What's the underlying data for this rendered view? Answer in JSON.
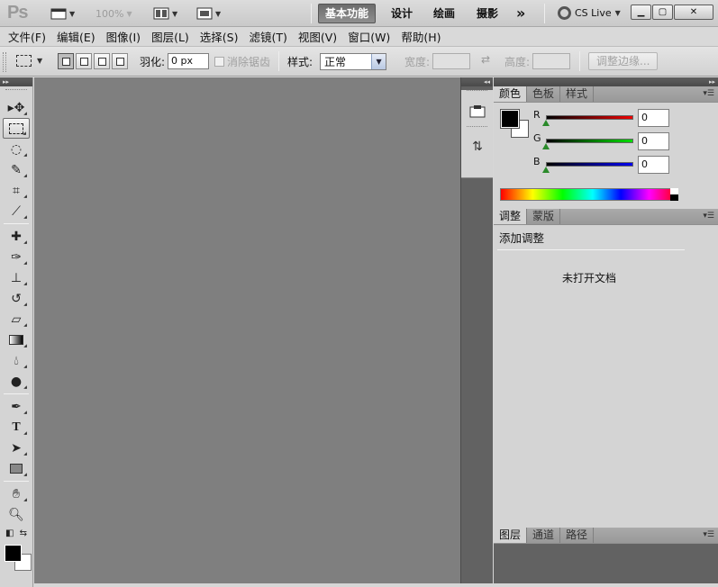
{
  "app": {
    "logo": "Ps",
    "zoom": "100%",
    "workspaces": [
      "基本功能",
      "设计",
      "绘画",
      "摄影"
    ],
    "active_workspace": 0,
    "more": "»",
    "cs_live": "CS Live"
  },
  "menu": [
    "文件(F)",
    "编辑(E)",
    "图像(I)",
    "图层(L)",
    "选择(S)",
    "滤镜(T)",
    "视图(V)",
    "窗口(W)",
    "帮助(H)"
  ],
  "options": {
    "feather_label": "羽化:",
    "feather_value": "0 px",
    "antialias_label": "消除锯齿",
    "style_label": "样式:",
    "style_value": "正常",
    "width_label": "宽度:",
    "height_label": "高度:",
    "refine_button": "调整边缘..."
  },
  "color_panel": {
    "tabs": [
      "颜色",
      "色板",
      "样式"
    ],
    "channels": [
      {
        "label": "R",
        "value": "0",
        "color": "#cc1111"
      },
      {
        "label": "G",
        "value": "0",
        "color": "#11aa11"
      },
      {
        "label": "B",
        "value": "0",
        "color": "#1111bb"
      }
    ]
  },
  "adjust_panel": {
    "tabs": [
      "调整",
      "蒙版"
    ],
    "title": "添加调整",
    "message": "未打开文档"
  },
  "layers_panel": {
    "tabs": [
      "图层",
      "通道",
      "路径"
    ]
  },
  "colors": {
    "canvas": "#7f7f7f",
    "panel_dark": "#626262",
    "ui": "#d4d4d4"
  }
}
